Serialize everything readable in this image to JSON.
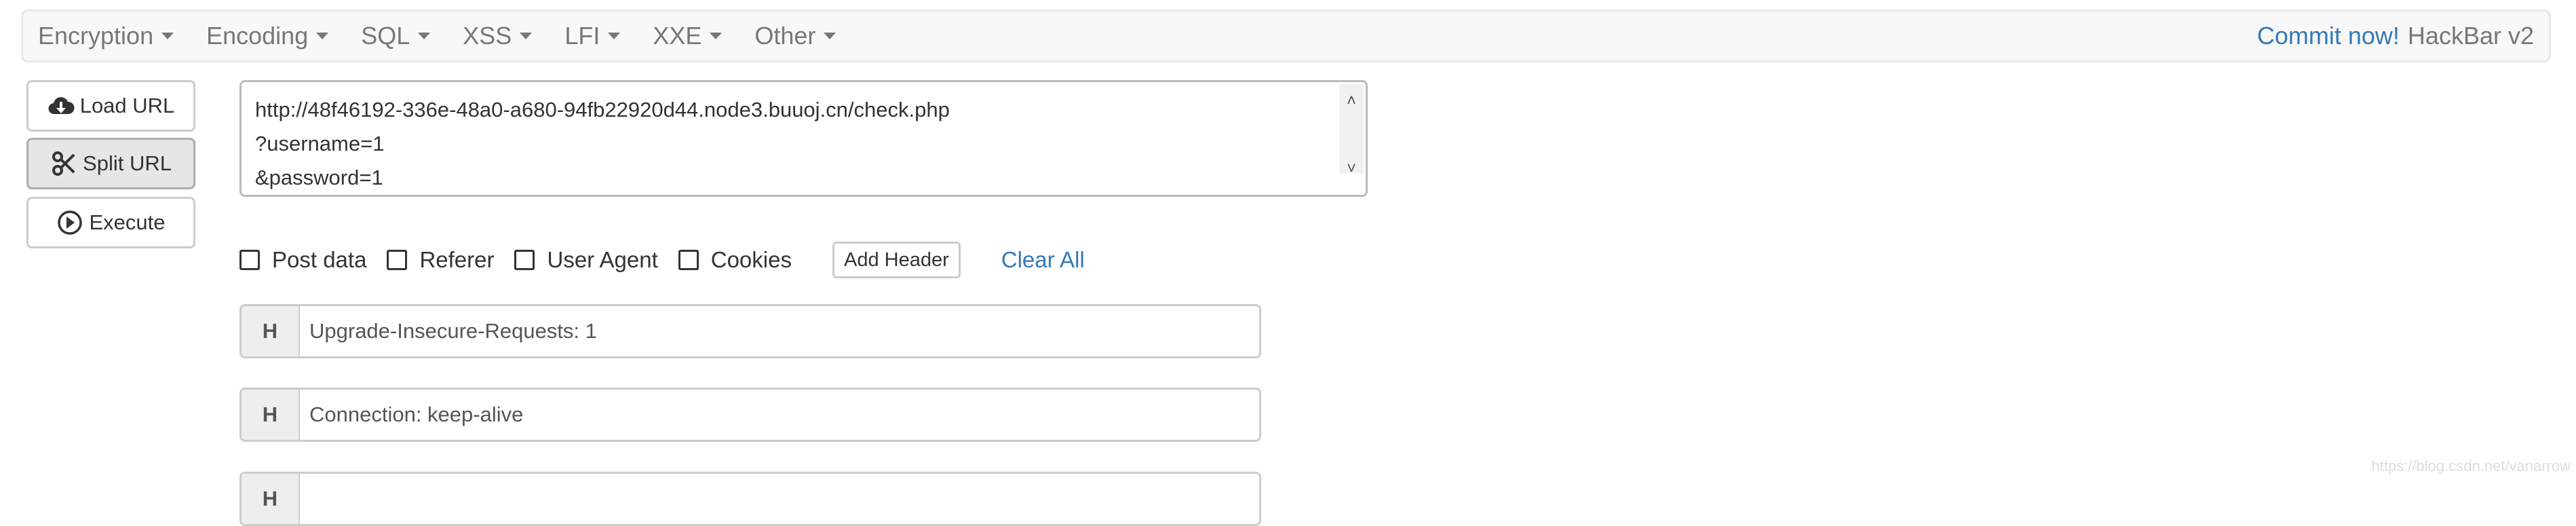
{
  "menu": [
    {
      "label": "Encryption"
    },
    {
      "label": "Encoding"
    },
    {
      "label": "SQL"
    },
    {
      "label": "XSS"
    },
    {
      "label": "LFI"
    },
    {
      "label": "XXE"
    },
    {
      "label": "Other"
    }
  ],
  "brand": {
    "commit": "Commit now!",
    "title": "HackBar v2"
  },
  "buttons": {
    "load": "Load URL",
    "split": "Split URL",
    "execute": "Execute"
  },
  "url": "http://48f46192-336e-48a0-a680-94fb22920d44.node3.buuoj.cn/check.php\n?username=1\n&password=1",
  "options": [
    {
      "label": "Post data",
      "checked": false
    },
    {
      "label": "Referer",
      "checked": false
    },
    {
      "label": "User Agent",
      "checked": false
    },
    {
      "label": "Cookies",
      "checked": false
    }
  ],
  "add_header": "Add Header",
  "clear_all": "Clear All",
  "headers": [
    {
      "tag": "H",
      "value": "Upgrade-Insecure-Requests: 1"
    },
    {
      "tag": "H",
      "value": "Connection: keep-alive"
    },
    {
      "tag": "H",
      "value": ""
    }
  ],
  "watermark": "https://blog.csdn.net/vanarrow",
  "colors": {
    "link": "#337ab7",
    "toolbar_bg": "#f8f8f8"
  }
}
